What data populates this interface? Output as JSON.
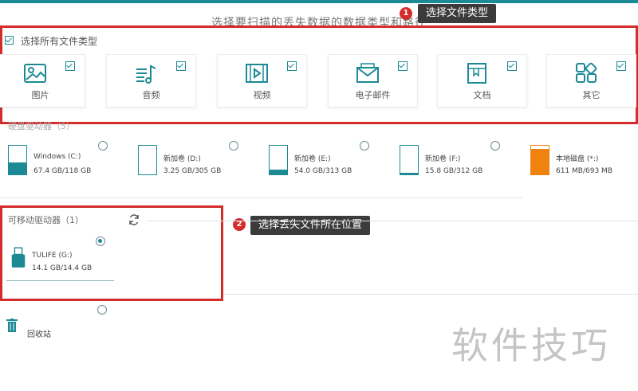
{
  "header": {
    "title": "选择要扫描的丢失数据的数据类型和路径"
  },
  "file_types": {
    "select_all_label": "选择所有文件类型",
    "items": [
      {
        "label": "图片",
        "icon": "image-icon"
      },
      {
        "label": "音频",
        "icon": "music-icon"
      },
      {
        "label": "视频",
        "icon": "video-icon"
      },
      {
        "label": "电子邮件",
        "icon": "email-icon"
      },
      {
        "label": "文档",
        "icon": "document-icon"
      },
      {
        "label": "其它",
        "icon": "other-icon"
      }
    ]
  },
  "disks": {
    "title": "硬盘驱动器（5）",
    "items": [
      {
        "name": "Windows (C:)",
        "size": "67.4 GB/118 GB",
        "used": 0.43,
        "color": "#1c8a95"
      },
      {
        "name": "新加卷 (D:)",
        "size": "3.25 GB/305 GB",
        "used": 0.01,
        "color": "#1c8a95"
      },
      {
        "name": "新加卷 (E:)",
        "size": "54.0 GB/313 GB",
        "used": 0.17,
        "color": "#1c8a95"
      },
      {
        "name": "新加卷 (F:)",
        "size": "15.8 GB/312 GB",
        "used": 0.05,
        "color": "#1c8a95"
      },
      {
        "name": "本地磁盘 (*:)",
        "size": "611 MB/693 MB",
        "used": 0.88,
        "color": "#f0820f"
      }
    ]
  },
  "removable": {
    "title": "可移动驱动器（1）",
    "refresh_icon": "refresh-icon",
    "item": {
      "name": "TULIFE (G:)",
      "size": "14.1 GB/14.4 GB"
    }
  },
  "recycle": {
    "label": "回收站",
    "icon": "trash-icon"
  },
  "annotations": {
    "callout1_num": "1",
    "callout1_text": "选择文件类型",
    "callout2_num": "2",
    "callout2_text": "选择丢失文件所在位置",
    "highlight_color": "#d42b2b"
  },
  "watermark": "软件技巧",
  "colors": {
    "accent": "#1c8a95",
    "orange": "#f0820f"
  }
}
